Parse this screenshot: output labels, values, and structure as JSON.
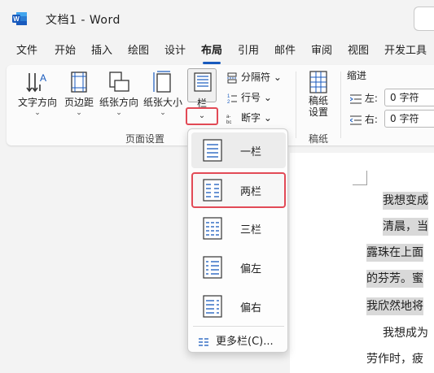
{
  "window": {
    "title": "文档1  -  Word"
  },
  "tabs": [
    "文件",
    "开始",
    "插入",
    "绘图",
    "设计",
    "布局",
    "引用",
    "邮件",
    "审阅",
    "视图",
    "开发工具"
  ],
  "active_tab": "布局",
  "ribbon": {
    "page_setup": {
      "text_direction": "文字方向",
      "margins": "页边距",
      "orientation": "纸张方向",
      "size": "纸张大小",
      "columns": "栏",
      "group_label": "页面设置"
    },
    "breaks": "分隔符",
    "line_numbers": "行号",
    "hyphenation": "断字",
    "manuscript": {
      "button": "稿纸\n设置",
      "group_label": "稿纸"
    },
    "indent": {
      "title": "缩进",
      "left_label": "左:",
      "left_value": "0 字符",
      "right_label": "右:",
      "right_value": "0 字符"
    }
  },
  "columns_menu": {
    "items": [
      {
        "label": "一栏",
        "icon": "one-column-icon"
      },
      {
        "label": "两栏",
        "icon": "two-columns-icon"
      },
      {
        "label": "三栏",
        "icon": "three-columns-icon"
      },
      {
        "label": "偏左",
        "icon": "left-column-icon"
      },
      {
        "label": "偏右",
        "icon": "right-column-icon"
      }
    ],
    "more": "更多栏(C)..."
  },
  "document": {
    "lines": [
      "我想变成",
      "清晨，当",
      "露珠在上面",
      "的芬芳。蜜",
      "我欣然地将",
      "我想成为",
      "劳作时，疲"
    ]
  },
  "colors": {
    "accent": "#185abd",
    "highlight_border": "#e24a56",
    "selection_bg": "#d9d9d9"
  }
}
